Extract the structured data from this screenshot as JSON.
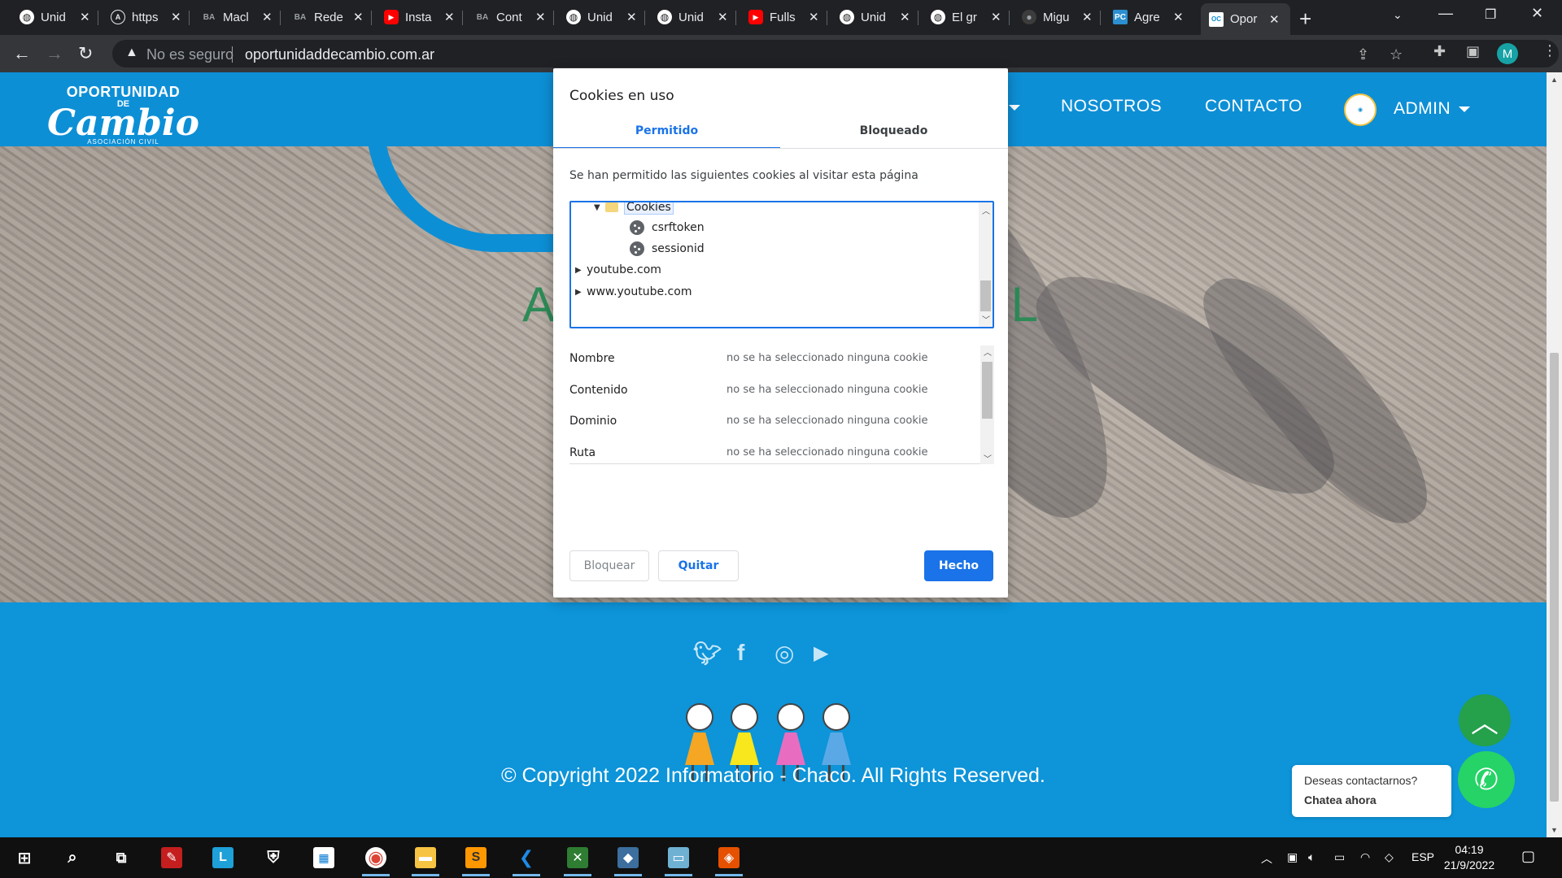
{
  "browser": {
    "tabs": [
      {
        "title": "Unid",
        "favicon": "globe-icon",
        "color": "#e8eaed"
      },
      {
        "title": "https",
        "favicon": "a-logo-icon",
        "color": "#e8eaed"
      },
      {
        "title": "Macl",
        "favicon": "ba-logo-icon",
        "color": "#9aa0a6"
      },
      {
        "title": "Rede",
        "favicon": "ba-logo-icon",
        "color": "#9aa0a6"
      },
      {
        "title": "Insta",
        "favicon": "youtube-icon",
        "color": "#ff0000"
      },
      {
        "title": "Cont",
        "favicon": "ba-logo-icon",
        "color": "#9aa0a6"
      },
      {
        "title": "Unid",
        "favicon": "globe-icon",
        "color": "#e8eaed"
      },
      {
        "title": "Unid",
        "favicon": "globe-icon",
        "color": "#e8eaed"
      },
      {
        "title": "Fulls",
        "favicon": "youtube-icon",
        "color": "#ff0000"
      },
      {
        "title": "Unid",
        "favicon": "globe-icon",
        "color": "#e8eaed"
      },
      {
        "title": "El gr",
        "favicon": "globe-icon",
        "color": "#e8eaed"
      },
      {
        "title": "Migu",
        "favicon": "github-icon",
        "color": "#3c3c3c"
      },
      {
        "title": "Agre",
        "favicon": "pc-logo-icon",
        "color": "#2b8fd1"
      },
      {
        "title": "Opor",
        "favicon": "site-logo-icon",
        "color": "#0d8fd6",
        "active": true
      }
    ],
    "omnibox": {
      "security_label": "No es seguro",
      "url": "oportunidaddecambio.com.ar"
    },
    "profile_initial": "M"
  },
  "site": {
    "logo": {
      "line1": "OPORTUNIDAD",
      "line2": "DE",
      "line3": "Cambio",
      "line4": "ASOCIACIÓN CIVIL"
    },
    "nav": {
      "nosotros": "NOSOTROS",
      "contacto": "CONTACTO",
      "admin": "ADMIN"
    },
    "hero": {
      "left_fragment": "A",
      "right_fragment": "IL"
    },
    "footer": {
      "social": [
        "twitter-icon",
        "facebook-icon",
        "instagram-icon",
        "youtube-icon"
      ],
      "copyright": "© Copyright 2022 Informatorio - Chaco. All Rights Reserved."
    },
    "whatsapp": {
      "line1": "Deseas contactarnos?",
      "line2": "Chatea ahora"
    }
  },
  "dialog": {
    "title": "Cookies en uso",
    "tabs": {
      "allowed": "Permitido",
      "blocked": "Bloqueado"
    },
    "description": "Se han permitido las siguientes cookies al visitar esta página",
    "tree": {
      "folder": "Cookies",
      "cookies": [
        "csrftoken",
        "sessionid"
      ],
      "domains": [
        "youtube.com",
        "www.youtube.com"
      ]
    },
    "details": [
      {
        "key": "Nombre",
        "value": "no se ha seleccionado ninguna cookie"
      },
      {
        "key": "Contenido",
        "value": "no se ha seleccionado ninguna cookie"
      },
      {
        "key": "Dominio",
        "value": "no se ha seleccionado ninguna cookie"
      },
      {
        "key": "Ruta",
        "value": "no se ha seleccionado ninguna cookie"
      }
    ],
    "buttons": {
      "block": "Bloquear",
      "remove": "Quitar",
      "done": "Hecho"
    }
  },
  "taskbar": {
    "apps": [
      "windows-start-icon",
      "search-icon",
      "task-view-icon",
      "acrobat-icon",
      "l-app-icon",
      "security-shield-icon",
      "store-icon",
      "chrome-icon",
      "file-explorer-icon",
      "sublime-icon",
      "vscode-icon",
      "excel-vba-icon",
      "mysql-workbench-icon",
      "notepad-icon",
      "git-icon"
    ],
    "language": "ESP",
    "time": "04:19",
    "date": "21/9/2022"
  }
}
